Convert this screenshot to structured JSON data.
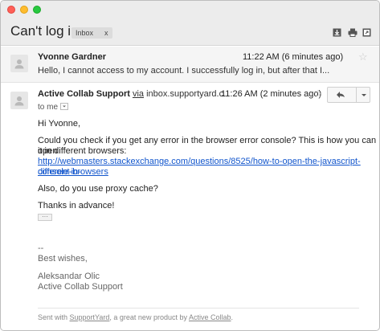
{
  "window": {
    "controls": [
      "close",
      "minimize",
      "zoom"
    ]
  },
  "thread": {
    "subject": "Can't log in",
    "label": "Inbox",
    "label_remove": "x",
    "header_icons": [
      "download-icon",
      "print-icon",
      "new-window-icon"
    ]
  },
  "message1": {
    "sender": "Yvonne Gardner",
    "time": "11:22 AM (6 minutes ago)",
    "snippet": "Hello, I cannot access to my account. I successfully log in, but after that I..."
  },
  "message2": {
    "sender": "Active Collab Support",
    "via": "via",
    "from_domain": "inbox.supportyard.c",
    "time": "11:26 AM (2 minutes ago)",
    "to": "to me",
    "greeting": "Hi Yvonne,",
    "para1_line1": "Could you check if you get any error in the browser error console? This is how you can open",
    "para1_line2": "it in different browsers:",
    "link_line1": "http://webmasters.stackexchange.com/questions/8525/how-to-open-the-javascript-console-in-",
    "link_line2": "different-browsers",
    "para2": "Also, do you use proxy cache?",
    "para3": "Thanks in advance!",
    "trimmed": "···",
    "sig_dash": "--",
    "sig_closing": "Best wishes,",
    "sig_name": "Aleksandar Olic",
    "sig_org": "Active Collab Support"
  },
  "footer": {
    "prefix": "Sent with ",
    "product": "SupportYard",
    "middle": ", a great new product by ",
    "company": "Active Collab",
    "suffix": "."
  }
}
